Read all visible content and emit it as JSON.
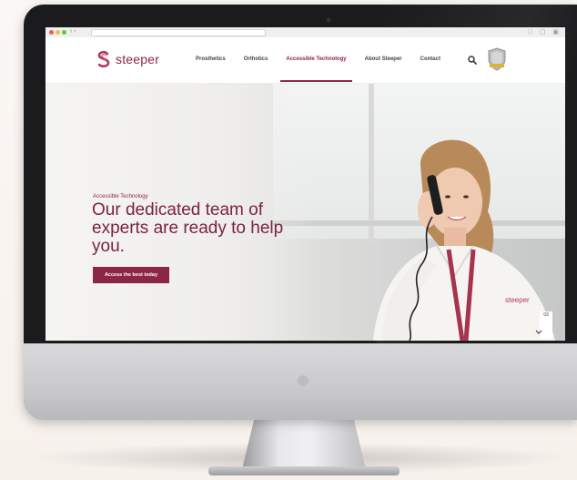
{
  "browser": {
    "nav_arrows": "‹ ›",
    "window_buttons": "□ ▢ ▣"
  },
  "site": {
    "logo_text": "steeper",
    "menu": [
      {
        "label": "Prosthetics"
      },
      {
        "label": "Orthotics"
      },
      {
        "label": "Accessible Technology"
      },
      {
        "label": "About Steeper"
      },
      {
        "label": "Contact"
      }
    ],
    "active_menu_index": 2,
    "brand_color": "#8c2646"
  },
  "hero": {
    "eyebrow": "Accessible Technology",
    "title": "Our dedicated team of experts are ready to help you.",
    "cta_label": "Access the best today",
    "slide_number": "03",
    "lanyard_logo_text": "steeper"
  },
  "icons": {
    "search": "search-icon",
    "badge": "shield-badge-icon"
  }
}
